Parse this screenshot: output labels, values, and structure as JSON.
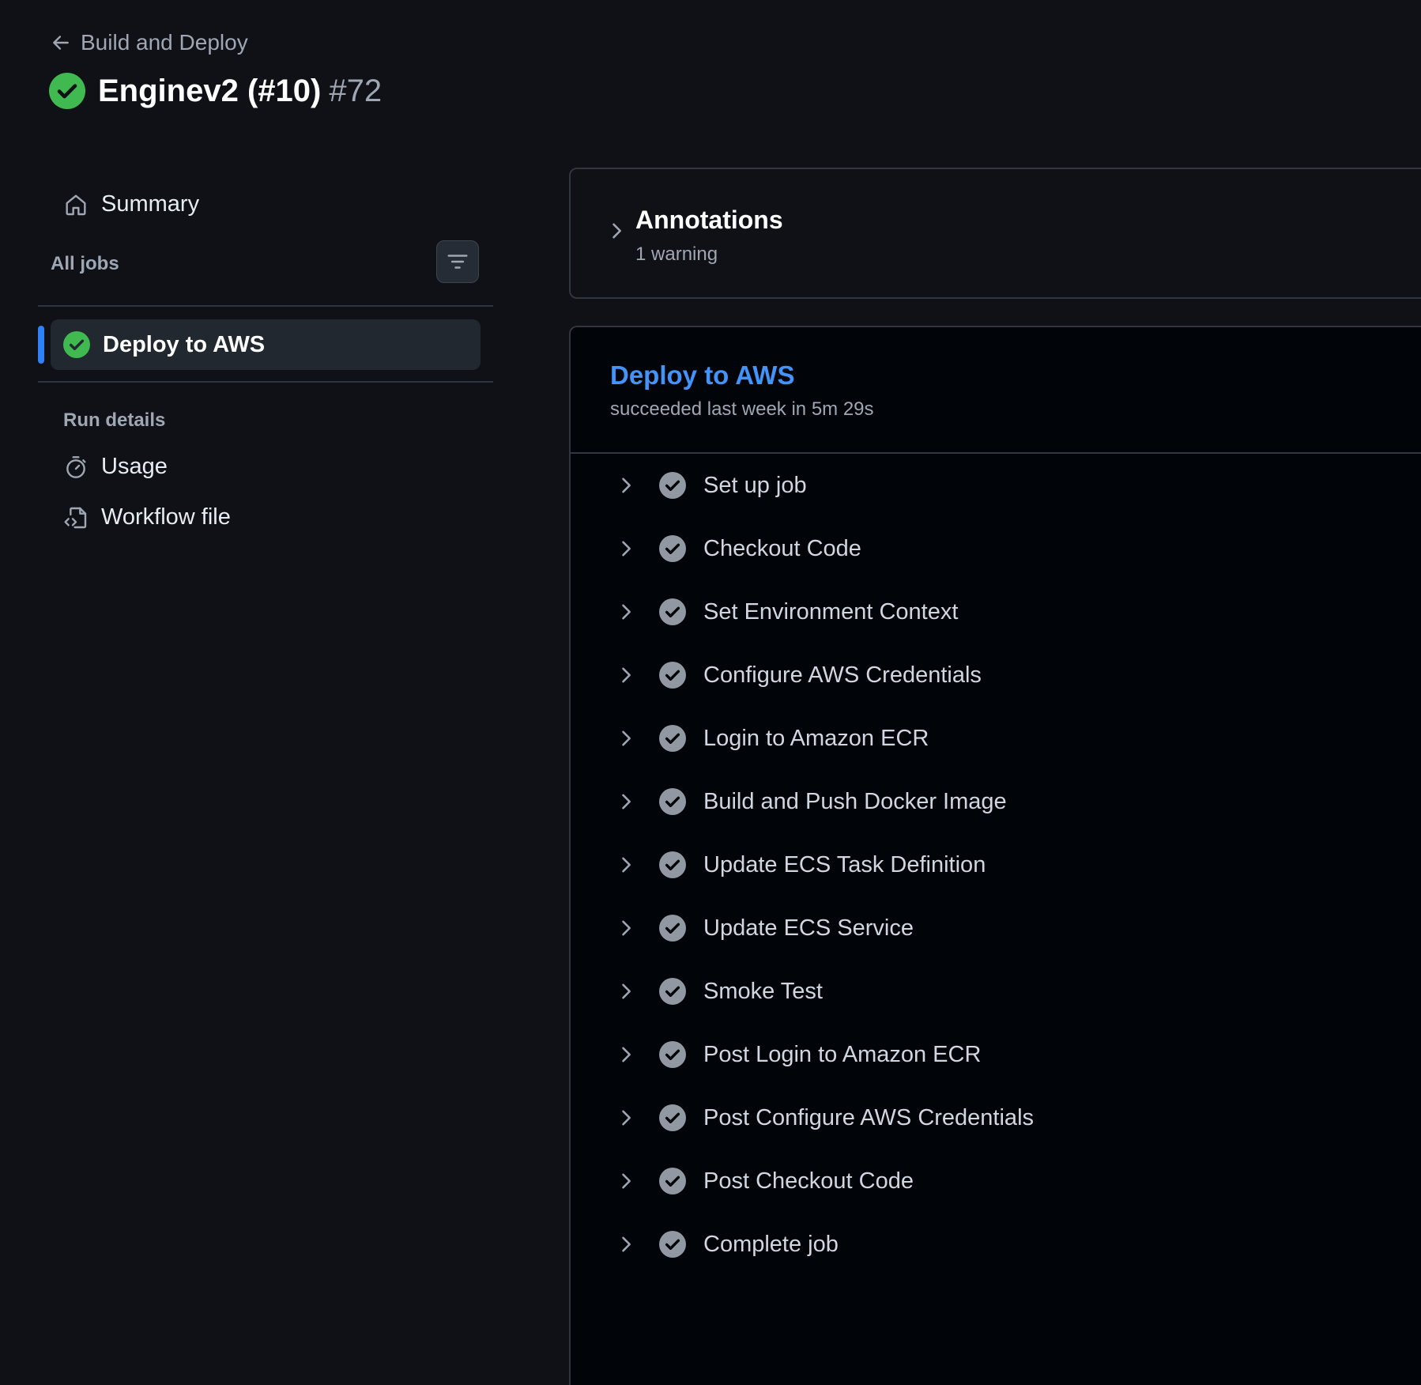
{
  "header": {
    "back_label": "Build and Deploy",
    "title": "Enginev2 (#10)",
    "run_number": "#72"
  },
  "sidebar": {
    "summary_label": "Summary",
    "all_jobs_label": "All jobs",
    "selected_job": "Deploy to AWS",
    "run_details_label": "Run details",
    "usage_label": "Usage",
    "workflow_file_label": "Workflow file"
  },
  "annotations": {
    "title": "Annotations",
    "subtitle": "1 warning"
  },
  "job": {
    "title": "Deploy to AWS",
    "subtitle": "succeeded last week in 5m 29s",
    "steps": [
      "Set up job",
      "Checkout Code",
      "Set Environment Context",
      "Configure AWS Credentials",
      "Login to Amazon ECR",
      "Build and Push Docker Image",
      "Update ECS Task Definition",
      "Update ECS Service",
      "Smoke Test",
      "Post Login to Amazon ECR",
      "Post Configure AWS Credentials",
      "Post Checkout Code",
      "Complete job"
    ]
  },
  "colors": {
    "success": "#3fb950",
    "accent": "#2f81f7",
    "link": "#4493f8",
    "step_check": "#9198a1"
  }
}
